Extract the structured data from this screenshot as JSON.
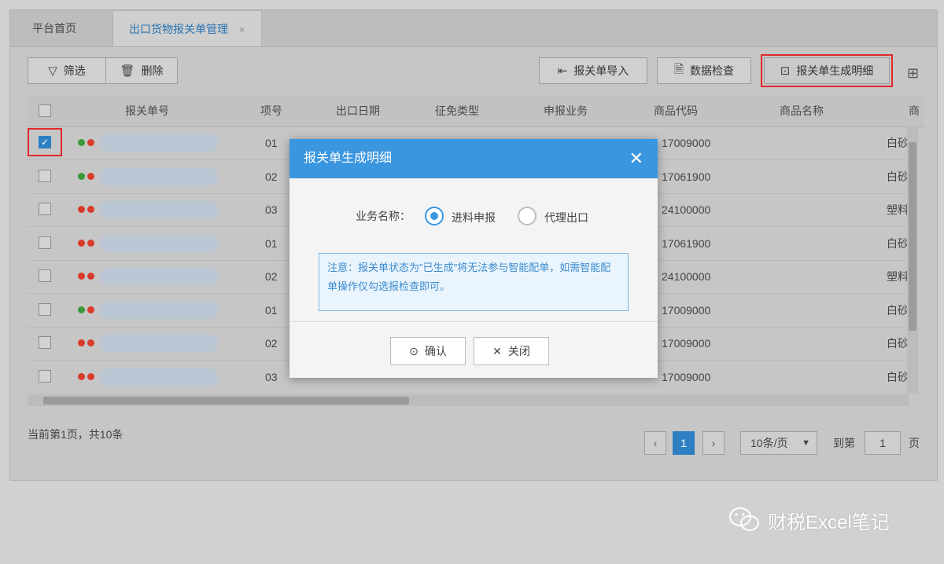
{
  "tabs": [
    {
      "label": "平台首页"
    },
    {
      "label": "出口货物报关单管理",
      "close": "×"
    }
  ],
  "toolbar": {
    "filter": "筛选",
    "delete": "删除",
    "import": "报关单导入",
    "check": "数据检查",
    "generate": "报关单生成明细"
  },
  "table": {
    "headers": [
      "报关单号",
      "项号",
      "出口日期",
      "征免类型",
      "申报业务",
      "商品代码",
      "商品名称",
      "商"
    ],
    "rows": [
      {
        "item": "01",
        "code": "17009000",
        "name": "白砂",
        "checked": true,
        "dots": [
          "#3a9a3a",
          "#d93b2b"
        ]
      },
      {
        "item": "02",
        "code": "17061900",
        "name": "白砂",
        "checked": false,
        "dots": [
          "#3a9a3a",
          "#d93b2b"
        ]
      },
      {
        "item": "03",
        "code": "24100000",
        "name": "塑料",
        "checked": false,
        "dots": [
          "#d93b2b",
          "#d93b2b"
        ]
      },
      {
        "item": "01",
        "code": "17061900",
        "name": "白砂",
        "checked": false,
        "dots": [
          "#d93b2b",
          "#d93b2b"
        ]
      },
      {
        "item": "02",
        "code": "24100000",
        "name": "塑料",
        "checked": false,
        "dots": [
          "#d93b2b",
          "#d93b2b"
        ]
      },
      {
        "item": "01",
        "code": "17009000",
        "name": "白砂",
        "checked": false,
        "dots": [
          "#3a9a3a",
          "#d93b2b"
        ]
      },
      {
        "item": "02",
        "code": "17009000",
        "name": "白砂",
        "checked": false,
        "dots": [
          "#d93b2b",
          "#d93b2b"
        ]
      },
      {
        "item": "03",
        "code": "17009000",
        "name": "白砂",
        "checked": false,
        "dots": [
          "#d93b2b",
          "#d93b2b"
        ]
      }
    ]
  },
  "footer": {
    "summary": "当前第1页，共10条",
    "page": "1",
    "per_page": "10条/页",
    "goto": "到第",
    "goto_value": "1",
    "page_suffix": "页"
  },
  "modal": {
    "title": "报关单生成明细",
    "business_label": "业务名称：",
    "option1": "进料申报",
    "option2": "代理出口",
    "note": "注意：报关单状态为\"已生成\"将无法参与智能配单，如需智能配单操作仅勾选报检查即可。",
    "confirm": "确认",
    "close": "关闭"
  },
  "watermark": "财税Excel笔记",
  "colors": {
    "accent": "#3b96e0",
    "highlight": "#e0292a"
  }
}
